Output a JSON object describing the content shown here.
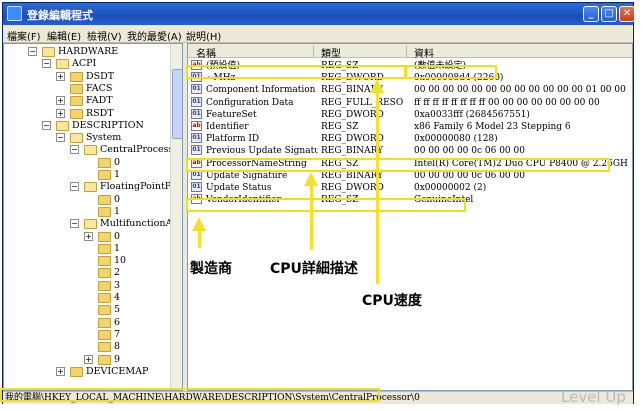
{
  "window": {
    "title": "登錄編輯程式",
    "minimize": "_",
    "maximize": "□",
    "close": "✕"
  },
  "menu": {
    "items": [
      "檔案(F)",
      "編輯(E)",
      "檢視(V)",
      "我的最愛(A)",
      "說明(H)"
    ]
  },
  "tree": {
    "items": [
      {
        "label": "HARDWARE",
        "expander": "−"
      },
      {
        "label": "ACPI",
        "expander": "−"
      },
      {
        "label": "DSDT",
        "expander": "+"
      },
      {
        "label": "FACS",
        "expander": ""
      },
      {
        "label": "FADT",
        "expander": "+"
      },
      {
        "label": "RSDT",
        "expander": "+"
      },
      {
        "label": "DESCRIPTION",
        "expander": "−"
      },
      {
        "label": "System",
        "expander": "−"
      },
      {
        "label": "CentralProcessor",
        "expander": "−"
      },
      {
        "label": "0",
        "expander": ""
      },
      {
        "label": "1",
        "expander": ""
      },
      {
        "label": "FloatingPointPr",
        "expander": "−"
      },
      {
        "label": "0",
        "expander": ""
      },
      {
        "label": "1",
        "expander": ""
      },
      {
        "label": "MultifunctionA",
        "expander": "−"
      },
      {
        "label": "0",
        "expander": "+"
      },
      {
        "label": "1",
        "expander": ""
      },
      {
        "label": "10",
        "expander": ""
      },
      {
        "label": "2",
        "expander": ""
      },
      {
        "label": "3",
        "expander": ""
      },
      {
        "label": "4",
        "expander": ""
      },
      {
        "label": "5",
        "expander": ""
      },
      {
        "label": "6",
        "expander": ""
      },
      {
        "label": "7",
        "expander": ""
      },
      {
        "label": "8",
        "expander": ""
      },
      {
        "label": "9",
        "expander": "+"
      },
      {
        "label": "DEVICEMAP",
        "expander": "+"
      }
    ]
  },
  "values": {
    "columns": {
      "name": "名稱",
      "type": "類型",
      "data": "資料"
    },
    "rows": [
      {
        "icon": "ab",
        "name": "(預設值)",
        "type": "REG_SZ",
        "data": "(數值未設定)"
      },
      {
        "icon": "bin",
        "name": "~MHz",
        "type": "REG_DWORD",
        "data": "0x000008d4 (2260)"
      },
      {
        "icon": "bin",
        "name": "Component Information",
        "type": "REG_BINARY",
        "data": "00 00 00 00 00 00 00 00 00 00 00 00 01 00 00 00"
      },
      {
        "icon": "bin",
        "name": "Configuration Data",
        "type": "REG_FULL_RESO",
        "data": "ff ff ff ff ff ff ff ff 00 00 00 00 00 00 00 00"
      },
      {
        "icon": "bin",
        "name": "FeatureSet",
        "type": "REG_DWORD",
        "data": "0xa0033fff (2684567551)"
      },
      {
        "icon": "ab",
        "name": "Identifier",
        "type": "REG_SZ",
        "data": "x86 Family 6 Model 23 Stepping 6"
      },
      {
        "icon": "bin",
        "name": "Platform ID",
        "type": "REG_DWORD",
        "data": "0x00000080 (128)"
      },
      {
        "icon": "bin",
        "name": "Previous Update Signature",
        "type": "REG_BINARY",
        "data": "00 00 00 00 0c 06 00 00"
      },
      {
        "icon": "ab",
        "name": "ProcessorNameString",
        "type": "REG_SZ",
        "data": "Intel(R) Core(TM)2 Duo CPU     P8400  @ 2.26GHz"
      },
      {
        "icon": "bin",
        "name": "Update Signature",
        "type": "REG_BINARY",
        "data": "00 00 00 00 0c 06 00 00"
      },
      {
        "icon": "bin",
        "name": "Update Status",
        "type": "REG_DWORD",
        "data": "0x00000002 (2)"
      },
      {
        "icon": "ab",
        "name": "VendorIdentifier",
        "type": "REG_SZ",
        "data": "GenuineIntel"
      }
    ]
  },
  "status_bar": {
    "path": "我的電腦\\HKEY_LOCAL_MACHINE\\HARDWARE\\DESCRIPTION\\System\\CentralProcessor\\0"
  },
  "annotations": {
    "vendor": "製造商",
    "cpu_detail": "CPU詳細描述",
    "cpu_speed": "CPU速度",
    "highlight_color": "#f0e01c"
  },
  "watermark": "Level Up"
}
